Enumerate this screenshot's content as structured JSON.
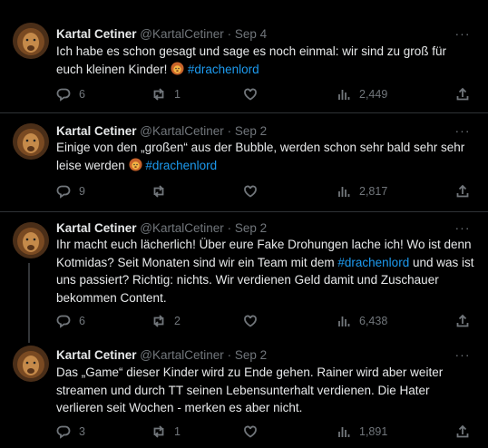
{
  "tweets": [
    {
      "name": "Kartal Cetiner",
      "handle": "@KartalCetiner",
      "separator": "·",
      "date": "Sep 4",
      "more": "···",
      "text_parts": [
        "Ich habe es schon gesagt und sage es noch einmal: wir sind zu groß für euch kleinen Kinder! ",
        "#drachenlord"
      ],
      "replies": "6",
      "reposts": "1",
      "likes": "",
      "views": "2,449"
    },
    {
      "name": "Kartal Cetiner",
      "handle": "@KartalCetiner",
      "separator": "·",
      "date": "Sep 2",
      "more": "···",
      "text_parts": [
        "Einige von den „großen“ aus der Bubble, werden schon sehr bald sehr sehr leise werden ",
        "#drachenlord"
      ],
      "replies": "9",
      "reposts": "",
      "likes": "",
      "views": "2,817"
    },
    {
      "name": "Kartal Cetiner",
      "handle": "@KartalCetiner",
      "separator": "·",
      "date": "Sep 2",
      "more": "···",
      "text_parts": [
        "Ihr macht euch lächerlich! Über eure Fake Drohungen lache ich! Wo ist denn Kotmidas? Seit Monaten sind wir ein Team mit dem ",
        "#drachenlord",
        " und was ist uns passiert? Richtig:  nichts. Wir verdienen Geld damit und Zuschauer bekommen Content."
      ],
      "replies": "6",
      "reposts": "2",
      "likes": "",
      "views": "6,438"
    },
    {
      "name": "Kartal Cetiner",
      "handle": "@KartalCetiner",
      "separator": "·",
      "date": "Sep 2",
      "more": "···",
      "text_parts": [
        "Das „Game“ dieser Kinder wird zu Ende gehen. Rainer wird aber weiter streamen und durch TT seinen Lebensunterhalt verdienen. Die Hater verlieren seit Wochen - merken es aber nicht."
      ],
      "replies": "3",
      "reposts": "1",
      "likes": "",
      "views": "1,891"
    }
  ],
  "colors": {
    "background": "#000000",
    "text": "#e7e9ea",
    "muted": "#71767b",
    "hashtag": "#1d9bf0",
    "divider": "#2f3336"
  },
  "icons": [
    "lion-avatar",
    "more-icon",
    "reply-icon",
    "repost-icon",
    "like-icon",
    "views-icon",
    "share-icon",
    "lion-emoji"
  ]
}
